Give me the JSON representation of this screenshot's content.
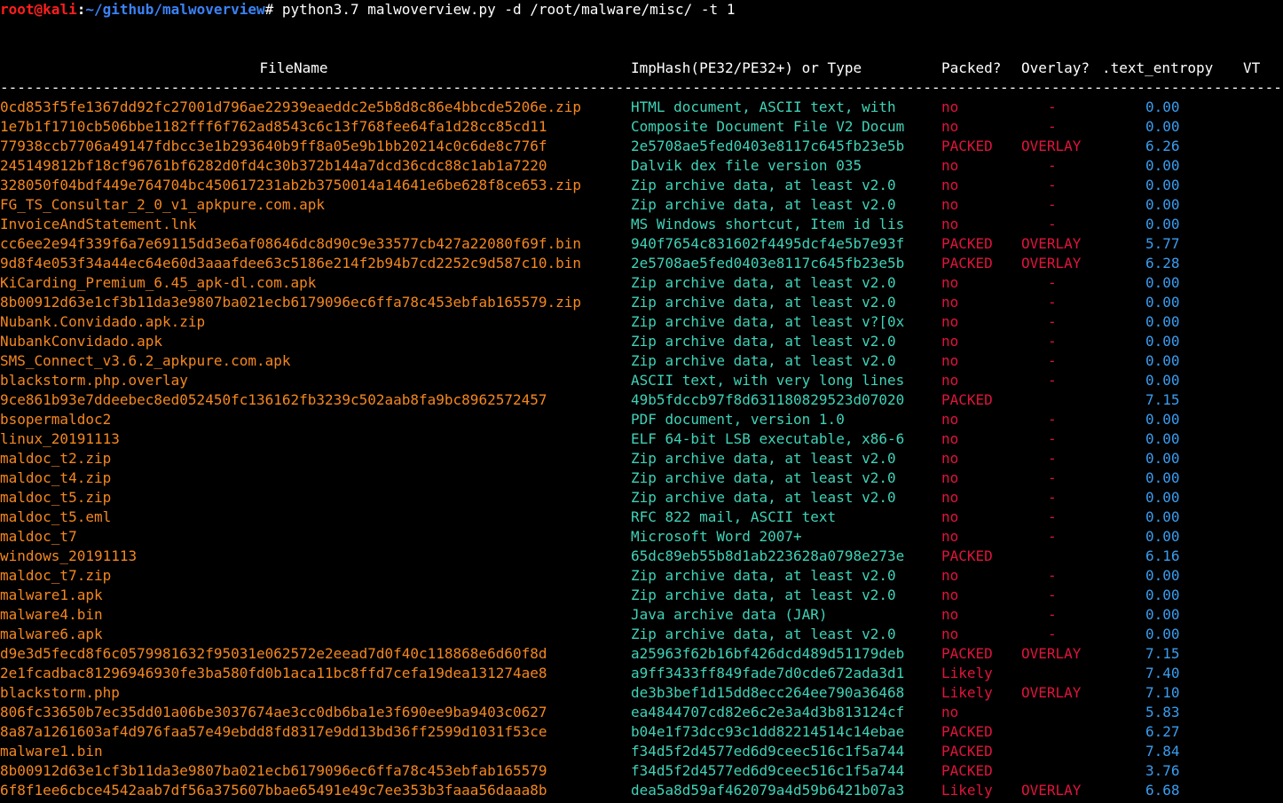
{
  "prompt": {
    "user": "root",
    "at": "@",
    "host": "kali",
    "colon": ":",
    "path": "~/github/malwoverview",
    "hash": "#",
    "command": " python3.7 malwoverview.py -d /root/malware/misc/ -t 1"
  },
  "header": {
    "filename": "FileName",
    "imphash": "ImpHash(PE32/PE32+) or Type",
    "packed": "Packed?",
    "overlay": "Overlay?",
    "entropy": ".text_entropy",
    "vt": "VT"
  },
  "separator": "-------------------------------------------------------------------------------------------------------------------------------------------------------------------------",
  "colors": {
    "background": "#000000",
    "filename": "#f5871f",
    "type": "#3fd3b8",
    "packed": "#e0143c",
    "overlay": "#e0143c",
    "entropy": "#3a9df0",
    "path": "#3b82f6",
    "user": "#ff1e1e"
  },
  "rows": [
    {
      "file": "0cd853f5fe1367dd92fc27001d796ae22939eaeddc2e5b8d8c86e4bbcde5206e.zip",
      "type": "HTML document, ASCII text, with",
      "packed": "no",
      "overlay": "-",
      "entropy": "0.00"
    },
    {
      "file": "1e7b1f1710cb506bbe1182fff6f762ad8543c6c13f768fee64fa1d28cc85cd11",
      "type": "Composite Document File V2 Docum",
      "packed": "no",
      "overlay": "-",
      "entropy": "0.00"
    },
    {
      "file": "77938ccb7706a49147fdbcc3e1b293640b9ff8a05e9b1bb20214c0c6de8c776f",
      "type": "2e5708ae5fed0403e8117c645fb23e5b",
      "packed": "PACKED",
      "overlay": "OVERLAY",
      "entropy": "6.26"
    },
    {
      "file": "245149812bf18cf96761bf6282d0fd4c30b372b144a7dcd36cdc88c1ab1a7220",
      "type": "Dalvik dex file version 035",
      "packed": "no",
      "overlay": "-",
      "entropy": "0.00"
    },
    {
      "file": "328050f04bdf449e764704bc450617231ab2b3750014a14641e6be628f8ce653.zip",
      "type": "Zip archive data, at least v2.0",
      "packed": "no",
      "overlay": "-",
      "entropy": "0.00"
    },
    {
      "file": "FG_TS_Consultar_2_0_v1_apkpure.com.apk",
      "type": "Zip archive data, at least v2.0",
      "packed": "no",
      "overlay": "-",
      "entropy": "0.00"
    },
    {
      "file": "InvoiceAndStatement.lnk",
      "type": "MS Windows shortcut, Item id lis",
      "packed": "no",
      "overlay": "-",
      "entropy": "0.00"
    },
    {
      "file": "cc6ee2e94f339f6a7e69115dd3e6af08646dc8d90c9e33577cb427a22080f69f.bin",
      "type": "940f7654c831602f4495dcf4e5b7e93f",
      "packed": "PACKED",
      "overlay": "OVERLAY",
      "entropy": "5.77"
    },
    {
      "file": "9d8f4e053f34a44ec64e60d3aaafdee63c5186e214f2b94b7cd2252c9d587c10.bin",
      "type": "2e5708ae5fed0403e8117c645fb23e5b",
      "packed": "PACKED",
      "overlay": "OVERLAY",
      "entropy": "6.28"
    },
    {
      "file": "KiCarding_Premium_6.45_apk-dl.com.apk",
      "type": "Zip archive data, at least v2.0",
      "packed": "no",
      "overlay": "-",
      "entropy": "0.00"
    },
    {
      "file": "8b00912d63e1cf3b11da3e9807ba021ecb6179096ec6ffa78c453ebfab165579.zip",
      "type": "Zip archive data, at least v2.0",
      "packed": "no",
      "overlay": "-",
      "entropy": "0.00"
    },
    {
      "file": "Nubank.Convidado.apk.zip",
      "type": "Zip archive data, at least v?[0x",
      "packed": "no",
      "overlay": "-",
      "entropy": "0.00"
    },
    {
      "file": "NubankConvidado.apk",
      "type": "Zip archive data, at least v2.0",
      "packed": "no",
      "overlay": "-",
      "entropy": "0.00"
    },
    {
      "file": "SMS_Connect_v3.6.2_apkpure.com.apk",
      "type": "Zip archive data, at least v2.0",
      "packed": "no",
      "overlay": "-",
      "entropy": "0.00"
    },
    {
      "file": "blackstorm.php.overlay",
      "type": "ASCII text, with very long lines",
      "packed": "no",
      "overlay": "-",
      "entropy": "0.00"
    },
    {
      "file": "9ce861b93e7ddeebec8ed052450fc136162fb3239c502aab8fa9bc8962572457",
      "type": "49b5fdccb97f8d631180829523d07020",
      "packed": "PACKED",
      "overlay": "",
      "entropy": "7.15"
    },
    {
      "file": "bsopermaldoc2",
      "type": "PDF document, version 1.0",
      "packed": "no",
      "overlay": "-",
      "entropy": "0.00"
    },
    {
      "file": "linux_20191113",
      "type": "ELF 64-bit LSB executable, x86-6",
      "packed": "no",
      "overlay": "-",
      "entropy": "0.00"
    },
    {
      "file": "maldoc_t2.zip",
      "type": "Zip archive data, at least v2.0",
      "packed": "no",
      "overlay": "-",
      "entropy": "0.00"
    },
    {
      "file": "maldoc_t4.zip",
      "type": "Zip archive data, at least v2.0",
      "packed": "no",
      "overlay": "-",
      "entropy": "0.00"
    },
    {
      "file": "maldoc_t5.zip",
      "type": "Zip archive data, at least v2.0",
      "packed": "no",
      "overlay": "-",
      "entropy": "0.00"
    },
    {
      "file": "maldoc_t5.eml",
      "type": "RFC 822 mail, ASCII text",
      "packed": "no",
      "overlay": "-",
      "entropy": "0.00"
    },
    {
      "file": "maldoc_t7",
      "type": "Microsoft Word 2007+",
      "packed": "no",
      "overlay": "-",
      "entropy": "0.00"
    },
    {
      "file": "windows_20191113",
      "type": "65dc89eb55b8d1ab223628a0798e273e",
      "packed": "PACKED",
      "overlay": "",
      "entropy": "6.16"
    },
    {
      "file": "maldoc_t7.zip",
      "type": "Zip archive data, at least v2.0",
      "packed": "no",
      "overlay": "-",
      "entropy": "0.00"
    },
    {
      "file": "malware1.apk",
      "type": "Zip archive data, at least v2.0",
      "packed": "no",
      "overlay": "-",
      "entropy": "0.00"
    },
    {
      "file": "malware4.bin",
      "type": "Java archive data (JAR)",
      "packed": "no",
      "overlay": "-",
      "entropy": "0.00"
    },
    {
      "file": "malware6.apk",
      "type": "Zip archive data, at least v2.0",
      "packed": "no",
      "overlay": "-",
      "entropy": "0.00"
    },
    {
      "file": "d9e3d5fecd8f6c0579981632f95031e062572e2eead7d0f40c118868e6d60f8d",
      "type": "a25963f62b16bf426dcd489d51179deb",
      "packed": "PACKED",
      "overlay": "OVERLAY",
      "entropy": "7.15"
    },
    {
      "file": "2e1fcadbac81296946930fe3ba580fd0b1aca11bc8ffd7cefa19dea131274ae8",
      "type": "a9ff3433ff849fade7d0cde672ada3d1",
      "packed": "Likely",
      "overlay": "",
      "entropy": "7.40"
    },
    {
      "file": "blackstorm.php",
      "type": "de3b3bef1d15dd8ecc264ee790a36468",
      "packed": "Likely",
      "overlay": "OVERLAY",
      "entropy": "7.10"
    },
    {
      "file": "806fc33650b7ec35dd01a06be3037674ae3cc0db6ba1e3f690ee9ba9403c0627",
      "type": "ea4844707cd82e6c2e3a4d3b813124cf",
      "packed": "no",
      "overlay": "",
      "entropy": "5.83"
    },
    {
      "file": "8a87a1261603af4d976faa57e49ebdd8fd8317e9dd13bd36ff2599d1031f53ce",
      "type": "b04e1f73dcc93c1dd82214514c14ebae",
      "packed": "PACKED",
      "overlay": "",
      "entropy": "6.27"
    },
    {
      "file": "malware1.bin",
      "type": "f34d5f2d4577ed6d9ceec516c1f5a744",
      "packed": "PACKED",
      "overlay": "",
      "entropy": "7.84"
    },
    {
      "file": "8b00912d63e1cf3b11da3e9807ba021ecb6179096ec6ffa78c453ebfab165579",
      "type": "f34d5f2d4577ed6d9ceec516c1f5a744",
      "packed": "PACKED",
      "overlay": "",
      "entropy": "3.76"
    },
    {
      "file": "6f8f1ee6cbce4542aab7df56a375607bbae65491e49c7ee353b3faaa56daaa8b",
      "type": "dea5a8d59af462079a4d59b6421b07a3",
      "packed": "Likely",
      "overlay": "OVERLAY",
      "entropy": "6.68"
    }
  ]
}
